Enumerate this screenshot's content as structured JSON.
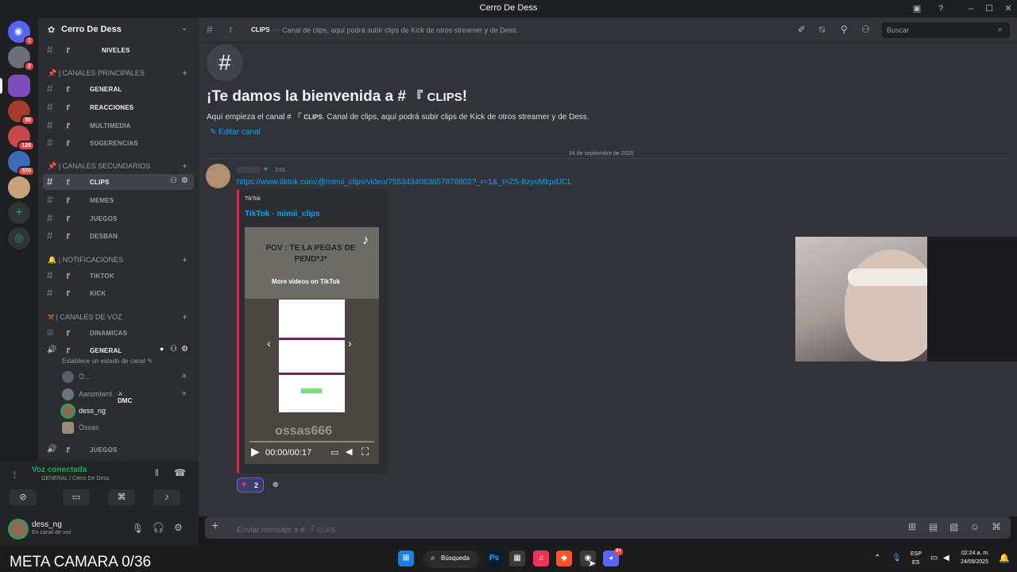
{
  "window": {
    "title": "Cerro De Dess"
  },
  "servers": {
    "badges": [
      "1",
      "2",
      "50",
      "129",
      "370"
    ]
  },
  "guild": {
    "name": "Cerro De Dess"
  },
  "channels": {
    "niveles": "NIVELES",
    "cat_principales": "| CANALES PRINCIPALES",
    "general": "GENERAL",
    "reacciones": "REACCIONES",
    "multimedia": "MULTIMEDIA",
    "sugerencias": "SUGERENCIAS",
    "cat_secundarios": "| CANALES SECUNDARIOS",
    "clips": "CLIPS",
    "memes": "MEMES",
    "juegos": "JUEGOS",
    "desban": "DESBAN",
    "cat_notificaciones": "| NOTIFICACIONES",
    "tiktok": "TIKTOK",
    "kick": "KICK",
    "cat_voz": "| CANALES DE VOZ",
    "dinamicas": "DINAMICAS",
    "voice_general": "GENERAL",
    "voice_status": "Establece un estado de canal",
    "voice_juegos": "JUEGOS",
    "emoji_bracket": "『"
  },
  "voice_users": [
    {
      "name": "O..."
    },
    {
      "name": "Aaromiwnl",
      "tag": "DMC"
    },
    {
      "name": "dess_ng"
    },
    {
      "name": "Ossas"
    }
  ],
  "voice_panel": {
    "status": "Voz conectada",
    "channel": "GENERAL / Cerro De Dess"
  },
  "user_panel": {
    "name": "dess_ng",
    "status": "En canal de voz"
  },
  "header": {
    "channel_name": "CLIPS",
    "topic": "Canal de clips, aquí podrá subir clips de Kick de otros streamer y de Dess.",
    "search_placeholder": "Buscar"
  },
  "welcome": {
    "title_prefix": "¡Te damos la bienvenida a #",
    "title_channel": "CLIPS",
    "title_suffix": "!",
    "desc_prefix": "Aquí empieza el canal #",
    "desc_channel": "CLIPS",
    "desc_suffix": ". Canal de clips, aquí podrá subir clips de Kick de otros streamer y de Dess.",
    "edit": "Editar canal"
  },
  "divider_date": "24 de septiembre de 2025",
  "message": {
    "time": "2:01",
    "link": "https://www.tiktok.com/@mimii_clips/video/7553434083657878802?_r=1&_t=ZS-8zyoMkpdJCL",
    "embed_provider": "TikTok",
    "embed_title": "TikTok · mimii_clips",
    "video_overlay": "POV : TE LA PEGAS DE PEND*J*",
    "more_videos": "More videos on TikTok",
    "watermark": "ossas666",
    "video_time": "00:00/00:17",
    "reaction_count": "2"
  },
  "composer": {
    "placeholder_prefix": "Enviar mensaje a #",
    "placeholder_channel": "CLIPS"
  },
  "taskbar": {
    "search": "Búsqueda",
    "lang_top": "ESP",
    "lang_bottom": "ES",
    "time": "02:24 a. m.",
    "date": "24/09/2025",
    "discord_badge": "9+"
  },
  "overlay_text": "META CAMARA 0/36",
  "colors": {
    "accent": "#5865f2",
    "link": "#00a8fc",
    "embed_bar": "#ee1d52",
    "voice_green": "#23a55a",
    "mention_red": "#f23f43"
  }
}
